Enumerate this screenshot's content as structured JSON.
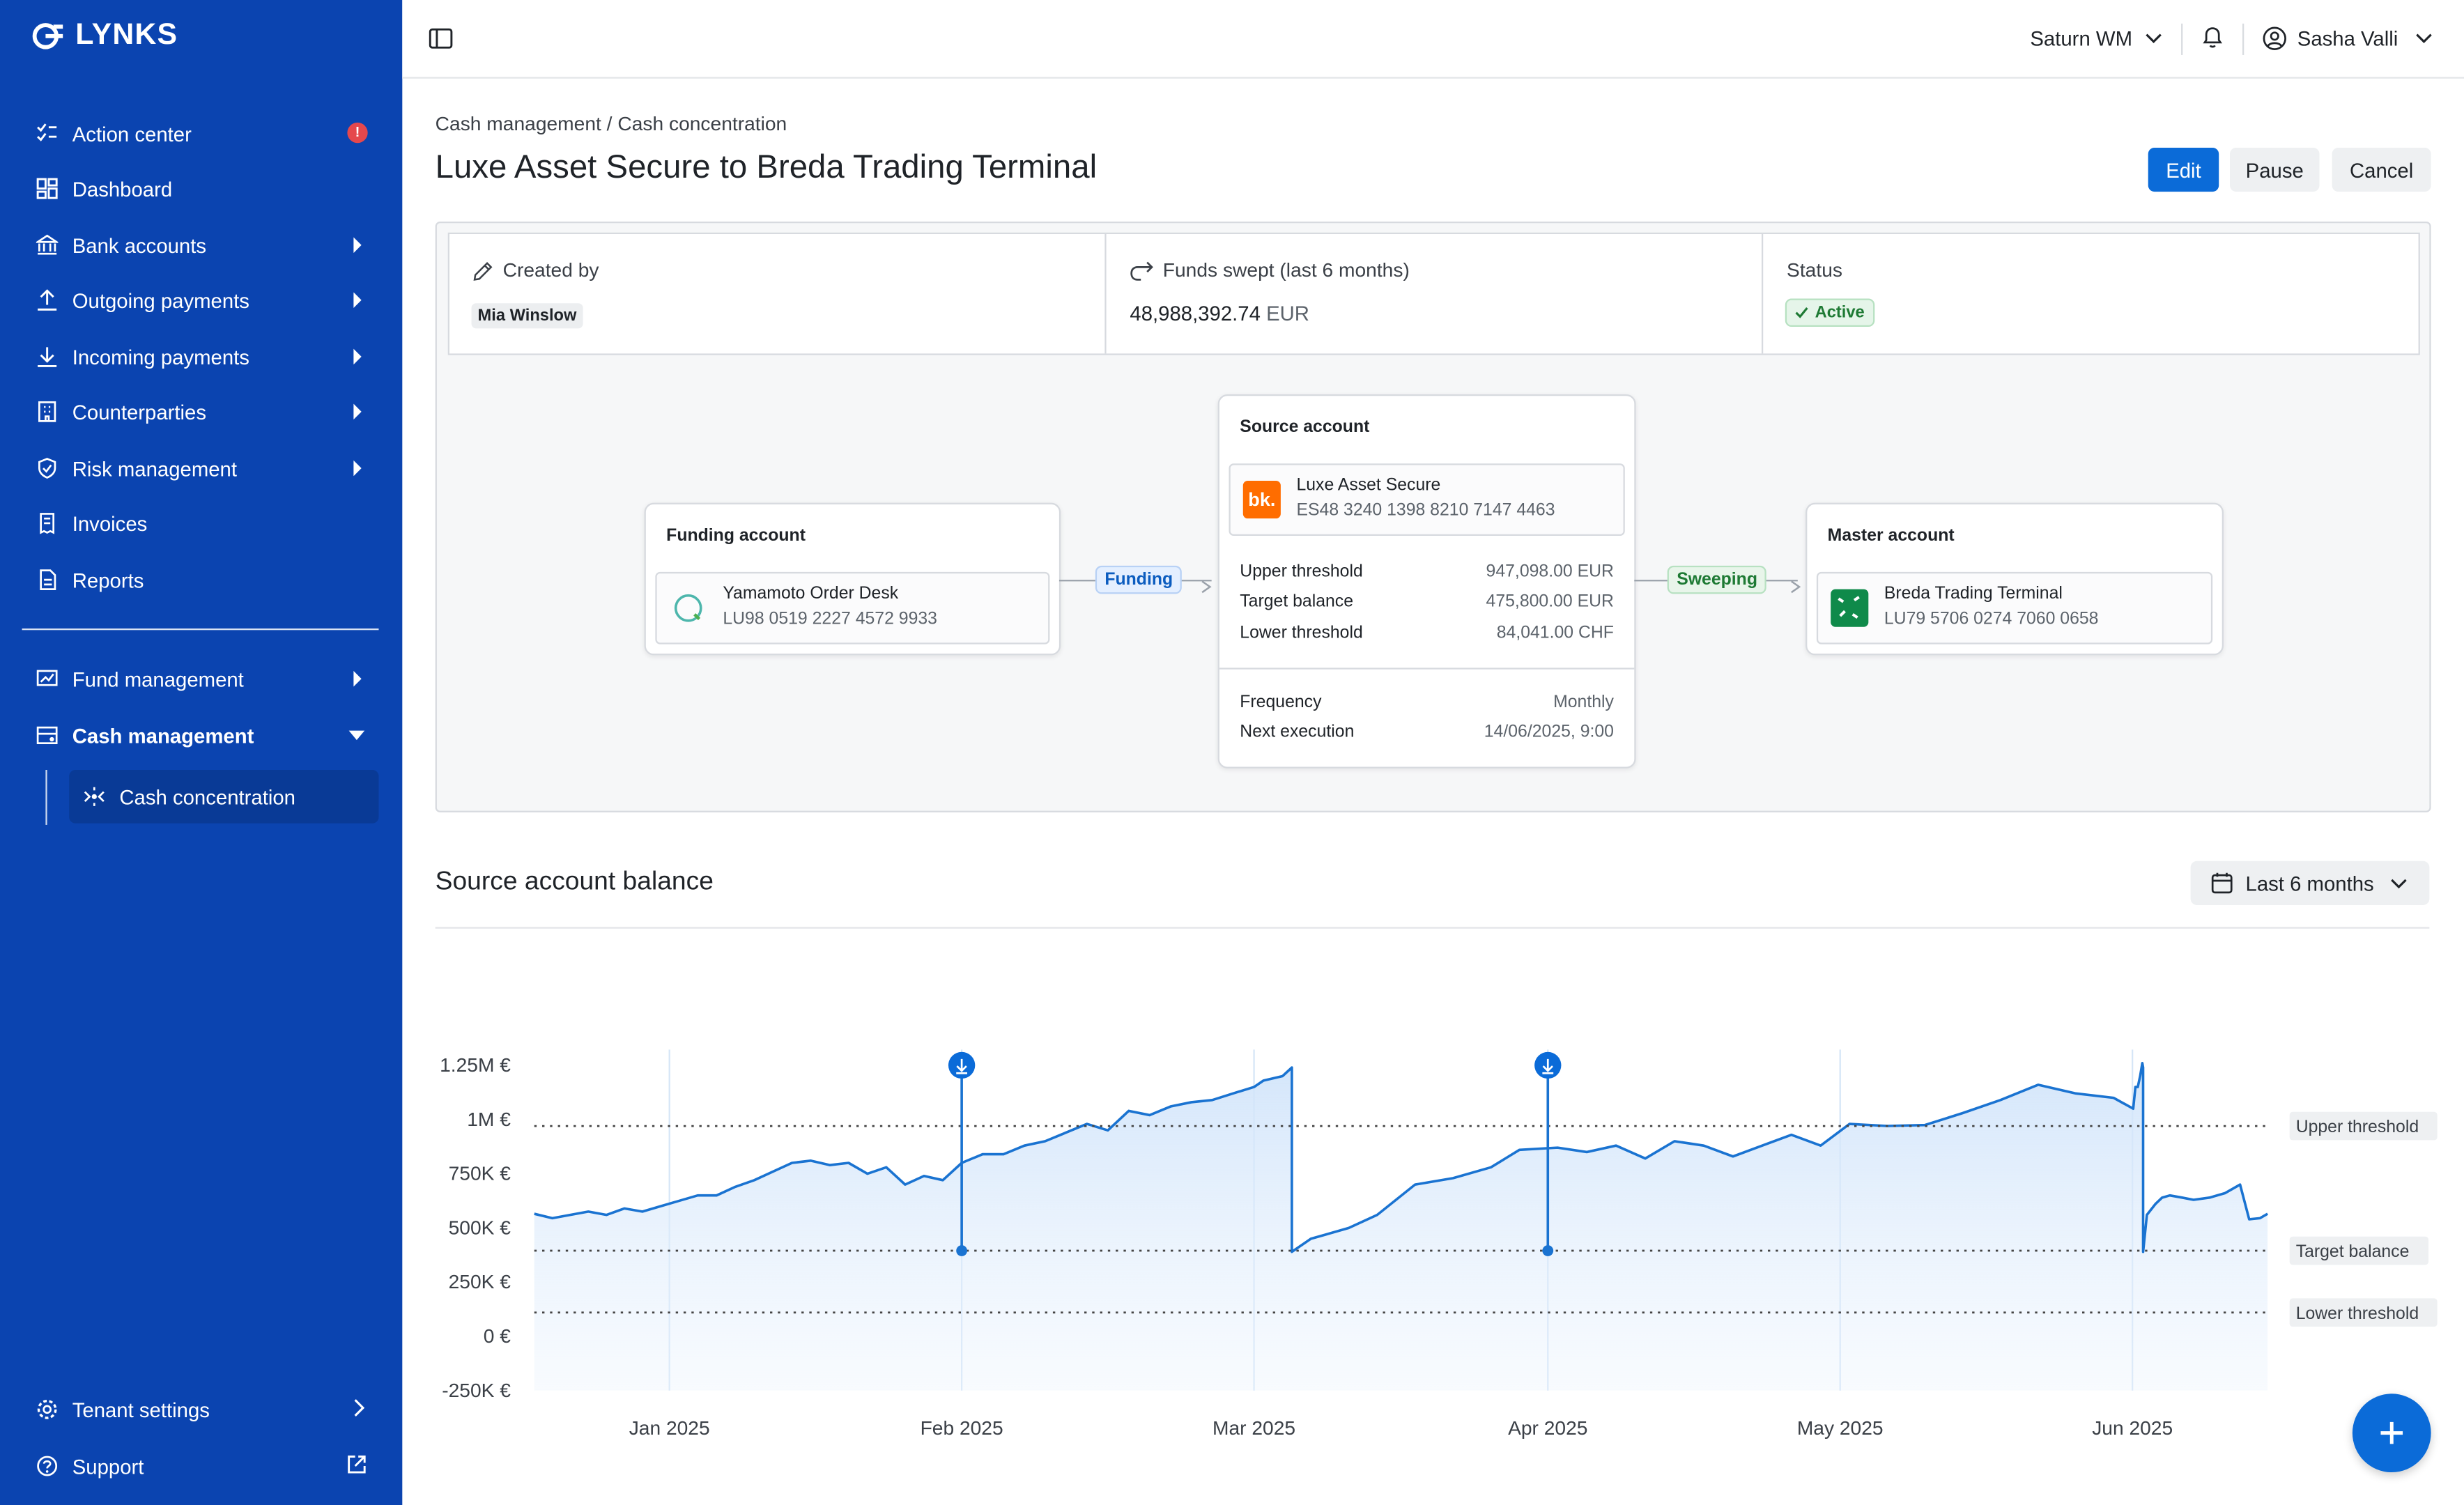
{
  "app": {
    "name": "LYNKS"
  },
  "sidebar": {
    "items": [
      {
        "label": "Action center",
        "icon": "checklist-icon",
        "badge": "!"
      },
      {
        "label": "Dashboard",
        "icon": "dashboard-icon"
      },
      {
        "label": "Bank accounts",
        "icon": "bank-icon"
      },
      {
        "label": "Outgoing payments",
        "icon": "upload-icon"
      },
      {
        "label": "Incoming payments",
        "icon": "download-icon"
      },
      {
        "label": "Counterparties",
        "icon": "building-icon"
      },
      {
        "label": "Risk management",
        "icon": "shield-icon"
      },
      {
        "label": "Invoices",
        "icon": "invoice-icon"
      },
      {
        "label": "Reports",
        "icon": "report-icon"
      }
    ],
    "secondary": [
      {
        "label": "Fund management",
        "icon": "fund-icon"
      },
      {
        "label": "Cash management",
        "icon": "cash-icon"
      }
    ],
    "active_sub": {
      "label": "Cash concentration",
      "icon": "concentration-icon"
    },
    "footer": [
      {
        "label": "Tenant settings",
        "icon": "gear-icon"
      },
      {
        "label": "Support",
        "icon": "help-icon"
      }
    ]
  },
  "topbar": {
    "workspace": "Saturn WM",
    "user": "Sasha Valli"
  },
  "page": {
    "breadcrumb": "Cash management / Cash concentration",
    "title": "Luxe Asset Secure to Breda Trading Terminal",
    "buttons": {
      "edit": "Edit",
      "pause": "Pause",
      "cancel": "Cancel"
    }
  },
  "info": {
    "created_by_label": "Created by",
    "created_by": "Mia Winslow",
    "swept_label": "Funds swept (last 6 months)",
    "swept_amount": "48,988,392.74",
    "swept_currency": "EUR",
    "status_label": "Status",
    "status": "Active"
  },
  "flow": {
    "funding": {
      "title": "Funding account",
      "name": "Yamamoto Order Desk",
      "iban": "LU98 0519 2227 4572 9933"
    },
    "funding_label": "Funding",
    "source": {
      "title": "Source account",
      "name": "Luxe Asset Secure",
      "iban": "ES48 3240 1398 8210 7147 4463",
      "bank_logo_text": "bk.",
      "upper_label": "Upper threshold",
      "upper": "947,098.00 EUR",
      "target_label": "Target balance",
      "target": "475,800.00 EUR",
      "lower_label": "Lower threshold",
      "lower": "84,041.00 CHF",
      "freq_label": "Frequency",
      "freq": "Monthly",
      "next_label": "Next execution",
      "next": "14/06/2025, 9:00"
    },
    "sweeping_label": "Sweeping",
    "master": {
      "title": "Master account",
      "name": "Breda Trading Terminal",
      "iban": "LU79 5706 0274 7060 0658"
    }
  },
  "balance_section": {
    "title": "Source account balance",
    "range": "Last 6 months"
  },
  "colors": {
    "sidebar": "#0b44b0",
    "accent": "#0b6bd8",
    "line": "#1a73d1"
  },
  "chart_data": {
    "type": "area",
    "y_tick_labels": [
      "1.25M €",
      "1M €",
      "750K €",
      "500K €",
      "250K €",
      "0 €",
      "-250K €"
    ],
    "y_ticks": [
      1250000,
      1000000,
      750000,
      500000,
      250000,
      0,
      -250000
    ],
    "ylim": [
      -250000,
      1250000
    ],
    "x_tick_labels": [
      "Jan 2025",
      "Feb 2025",
      "Mar 2025",
      "Apr 2025",
      "May 2025",
      "Jun 2025"
    ],
    "x_ticks": [
      "2025-01-01",
      "2025-02-01",
      "2025-03-01",
      "2025-04-01",
      "2025-05-01",
      "2025-06-01"
    ],
    "reference_lines": [
      {
        "label": "Upper threshold",
        "value": 970000
      },
      {
        "label": "Target balance",
        "value": 395000
      },
      {
        "label": "Lower threshold",
        "value": 110000
      }
    ],
    "sweep_events": [
      "2025-02-01",
      "2025-04-01"
    ],
    "series": [
      {
        "points": [
          [
            "2024-12-17",
            565000
          ],
          [
            "2024-12-19",
            545000
          ],
          [
            "2024-12-21",
            560000
          ],
          [
            "2024-12-23",
            575000
          ],
          [
            "2024-12-25",
            560000
          ],
          [
            "2024-12-27",
            590000
          ],
          [
            "2024-12-29",
            575000
          ],
          [
            "2024-12-31",
            600000
          ],
          [
            "2025-01-02",
            625000
          ],
          [
            "2025-01-04",
            650000
          ],
          [
            "2025-01-06",
            650000
          ],
          [
            "2025-01-08",
            690000
          ],
          [
            "2025-01-10",
            720000
          ],
          [
            "2025-01-12",
            760000
          ],
          [
            "2025-01-14",
            800000
          ],
          [
            "2025-01-16",
            810000
          ],
          [
            "2025-01-18",
            790000
          ],
          [
            "2025-01-20",
            800000
          ],
          [
            "2025-01-22",
            750000
          ],
          [
            "2025-01-24",
            780000
          ],
          [
            "2025-01-26",
            700000
          ],
          [
            "2025-01-28",
            740000
          ],
          [
            "2025-01-30",
            720000
          ],
          [
            "2025-02-01",
            800000
          ],
          [
            "2025-02-03",
            840000
          ],
          [
            "2025-02-05",
            840000
          ],
          [
            "2025-02-07",
            880000
          ],
          [
            "2025-02-09",
            900000
          ],
          [
            "2025-02-11",
            940000
          ],
          [
            "2025-02-13",
            980000
          ],
          [
            "2025-02-15",
            950000
          ],
          [
            "2025-02-17",
            1040000
          ],
          [
            "2025-02-19",
            1020000
          ],
          [
            "2025-02-21",
            1060000
          ],
          [
            "2025-02-23",
            1080000
          ],
          [
            "2025-02-25",
            1090000
          ],
          [
            "2025-02-27",
            1120000
          ],
          [
            "2025-02-29",
            1150000
          ],
          [
            "2025-03-02",
            1180000
          ],
          [
            "2025-03-04",
            1200000
          ],
          [
            "2025-03-05",
            1240000
          ],
          [
            "2025-03-05",
            390000
          ],
          [
            "2025-03-07",
            450000
          ],
          [
            "2025-03-11",
            500000
          ],
          [
            "2025-03-14",
            560000
          ],
          [
            "2025-03-18",
            700000
          ],
          [
            "2025-03-22",
            730000
          ],
          [
            "2025-03-26",
            780000
          ],
          [
            "2025-03-29",
            860000
          ],
          [
            "2025-04-02",
            870000
          ],
          [
            "2025-04-05",
            850000
          ],
          [
            "2025-04-08",
            880000
          ],
          [
            "2025-04-11",
            820000
          ],
          [
            "2025-04-14",
            900000
          ],
          [
            "2025-04-17",
            880000
          ],
          [
            "2025-04-20",
            830000
          ],
          [
            "2025-04-23",
            880000
          ],
          [
            "2025-04-26",
            930000
          ],
          [
            "2025-04-29",
            880000
          ],
          [
            "2025-05-02",
            980000
          ],
          [
            "2025-05-06",
            970000
          ],
          [
            "2025-05-10",
            975000
          ],
          [
            "2025-05-14",
            1030000
          ],
          [
            "2025-05-18",
            1090000
          ],
          [
            "2025-05-22",
            1160000
          ],
          [
            "2025-05-26",
            1120000
          ],
          [
            "2025-05-30",
            1100000
          ],
          [
            "2025-06-02",
            1050000
          ],
          [
            "2025-06-05",
            1150000
          ],
          [
            "2025-06-08",
            1150000
          ],
          [
            "2025-06-11",
            1200000
          ],
          [
            "2025-06-14",
            1260000
          ],
          [
            "2025-06-15",
            1240000
          ],
          [
            "2025-06-15",
            390000
          ],
          [
            "2025-06-20",
            560000
          ],
          [
            "2025-07-01",
            610000
          ],
          [
            "2025-07-10",
            640000
          ],
          [
            "2025-07-20",
            650000
          ],
          [
            "2025-08-05",
            640000
          ],
          [
            "2025-08-20",
            630000
          ],
          [
            "2025-09-10",
            640000
          ],
          [
            "2025-09-30",
            660000
          ],
          [
            "2025-10-20",
            700000
          ],
          [
            "2025-11-01",
            540000
          ],
          [
            "2025-11-15",
            545000
          ],
          [
            "2025-11-25",
            565000
          ]
        ]
      }
    ]
  }
}
